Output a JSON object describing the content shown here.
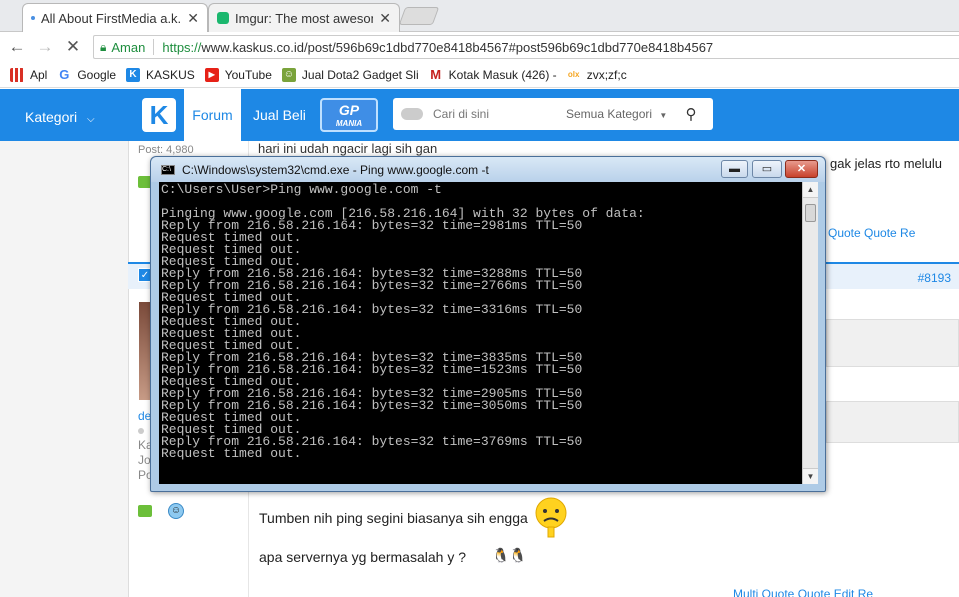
{
  "browser": {
    "tabs": [
      {
        "title": "All About FirstMedia a.k.a",
        "close": "✕"
      },
      {
        "title": "Imgur: The most aweson",
        "close": "✕"
      }
    ],
    "secure_label": "Aman",
    "url_scheme": "https://",
    "url_rest": "www.kaskus.co.id/post/596b69c1dbd770e8418b4567#post596b69c1dbd770e8418b4567"
  },
  "bookmarks": [
    {
      "label": "Apl",
      "icon": "apps-grid-icon",
      "color": "#d93025"
    },
    {
      "label": "Google",
      "icon": "google-icon",
      "color": "#4285f4"
    },
    {
      "label": "KASKUS",
      "icon": "kaskus-icon",
      "color": "#1e88e5"
    },
    {
      "label": "YouTube",
      "icon": "youtube-icon",
      "color": "#e62117"
    },
    {
      "label": "Jual Dota2 Gadget Sli",
      "icon": "shop-icon",
      "color": "#7aa33b"
    },
    {
      "label": "Kotak Masuk (426) -",
      "icon": "gmail-icon",
      "color": "#c5221f"
    },
    {
      "label": "zvx;zf;c",
      "icon": "olx-icon",
      "color": "#f5a623"
    }
  ],
  "kaskus": {
    "kategori": "Kategori",
    "forum": "Forum",
    "jual_beli": "Jual Beli",
    "gp_top": "GP",
    "gp_bottom": "MANIA",
    "search_placeholder": "Cari di sini",
    "search_category": "Semua Kategori",
    "accent": "#1e88e5"
  },
  "page": {
    "post_snippet": "hari ini udah ngacir lagi sih gan",
    "post_right_text": "gak jelas rto melulu",
    "post_small": "Post: 4,980",
    "actions_top": "Quote   Quote   Re",
    "post_number": "#8193",
    "user_name": "de",
    "user_line1": "Ka",
    "user_line2": "Jo",
    "user_line3": "Po",
    "message1": "Tumben nih ping segini biasanya sih engga",
    "message2": "apa servernya yg bermasalah y ?",
    "actions_bottom": "Multi Quote   Quote   Edit   Re"
  },
  "cmd": {
    "title": "C:\\Windows\\system32\\cmd.exe - Ping  www.google.com -t",
    "minimize": "▬",
    "maximize": "▭",
    "close": "✕",
    "lines": [
      "C:\\Users\\User>Ping www.google.com -t",
      "",
      "Pinging www.google.com [216.58.216.164] with 32 bytes of data:",
      "Reply from 216.58.216.164: bytes=32 time=2981ms TTL=50",
      "Request timed out.",
      "Request timed out.",
      "Request timed out.",
      "Reply from 216.58.216.164: bytes=32 time=3288ms TTL=50",
      "Reply from 216.58.216.164: bytes=32 time=2766ms TTL=50",
      "Request timed out.",
      "Reply from 216.58.216.164: bytes=32 time=3316ms TTL=50",
      "Request timed out.",
      "Request timed out.",
      "Request timed out.",
      "Reply from 216.58.216.164: bytes=32 time=3835ms TTL=50",
      "Reply from 216.58.216.164: bytes=32 time=1523ms TTL=50",
      "Request timed out.",
      "Reply from 216.58.216.164: bytes=32 time=2905ms TTL=50",
      "Reply from 216.58.216.164: bytes=32 time=3050ms TTL=50",
      "Request timed out.",
      "Request timed out.",
      "Reply from 216.58.216.164: bytes=32 time=3769ms TTL=50",
      "Request timed out."
    ]
  }
}
